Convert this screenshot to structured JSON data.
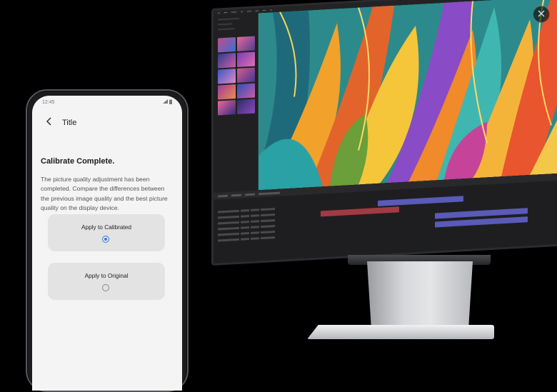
{
  "dialog": {
    "close_icon": "close-icon"
  },
  "phone": {
    "status": {
      "time": "12:45",
      "icons": [
        "signal-icon",
        "battery-icon"
      ]
    },
    "appbar": {
      "back_icon": "chevron-left-icon",
      "title": "Title"
    },
    "headline": "Calibrate Complete.",
    "description": "The picture quality adjustment has been completed. Compare the differences between the previous image quality and the best picture quality on the display device.",
    "options": [
      {
        "label": "Apply to Calibrated",
        "selected": true
      },
      {
        "label": "Apply to Original",
        "selected": false
      }
    ],
    "accent_color": "#3d7be5"
  },
  "monitor": {
    "app": "photo-editing-application",
    "canvas_subject": "colorful tropical leaves artwork",
    "thumbnail_count": 10
  }
}
